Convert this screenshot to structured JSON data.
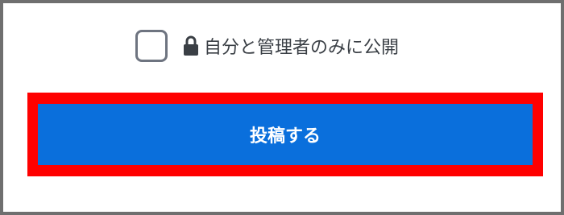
{
  "privacy_option": {
    "checked": false,
    "label": "自分と管理者のみに公開",
    "icon": "lock-icon"
  },
  "submit": {
    "label": "投稿する",
    "highlight_color": "#ff0000",
    "button_color": "#0a6fdc"
  }
}
